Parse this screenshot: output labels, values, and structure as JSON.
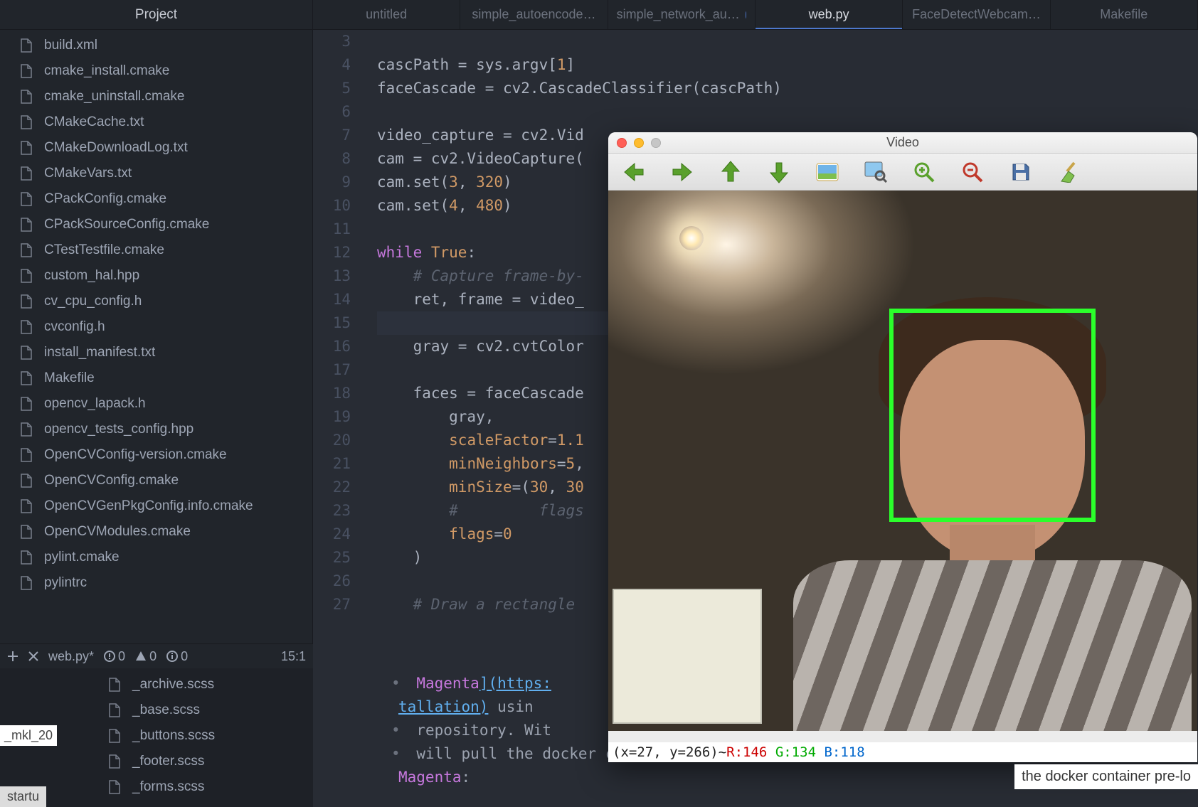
{
  "sidebar": {
    "title": "Project",
    "items": [
      "build.xml",
      "cmake_install.cmake",
      "cmake_uninstall.cmake",
      "CMakeCache.txt",
      "CMakeDownloadLog.txt",
      "CMakeVars.txt",
      "CPackConfig.cmake",
      "CPackSourceConfig.cmake",
      "CTestTestfile.cmake",
      "custom_hal.hpp",
      "cv_cpu_config.h",
      "cvconfig.h",
      "install_manifest.txt",
      "Makefile",
      "opencv_lapack.h",
      "opencv_tests_config.hpp",
      "OpenCVConfig-version.cmake",
      "OpenCVConfig.cmake",
      "OpenCVGenPkgConfig.info.cmake",
      "OpenCVModules.cmake",
      "pylint.cmake",
      "pylintrc"
    ]
  },
  "tabs": [
    {
      "label": "untitled",
      "active": false,
      "modified": false
    },
    {
      "label": "simple_autoencode…",
      "active": false,
      "modified": false
    },
    {
      "label": "simple_network_au…",
      "active": false,
      "modified": true
    },
    {
      "label": "web.py",
      "active": true,
      "modified": false
    },
    {
      "label": "FaceDetectWebcam…",
      "active": false,
      "modified": false
    },
    {
      "label": "Makefile",
      "active": false,
      "modified": false
    }
  ],
  "gutter_start": 3,
  "gutter_end": 27,
  "code": {
    "l3": "",
    "l4_a": "cascPath = sys.argv[",
    "l4_b": "1",
    "l4_c": "]",
    "l5": "faceCascade = cv2.CascadeClassifier(cascPath)",
    "l6": "",
    "l7": "video_capture = cv2.Vid",
    "l8": "cam = cv2.VideoCapture(",
    "l9_a": "cam.set(",
    "l9_b": "3",
    "l9_c": ", ",
    "l9_d": "320",
    "l9_e": ")",
    "l10_a": "cam.set(",
    "l10_b": "4",
    "l10_c": ", ",
    "l10_d": "480",
    "l10_e": ")",
    "l11": "",
    "l12_a": "while",
    "l12_b": " True",
    "l12_c": ":",
    "l13": "    # Capture frame-by-",
    "l14": "    ret, frame = video_",
    "l15": "",
    "l16": "    gray = cv2.cvtColor",
    "l17": "",
    "l18": "    faces = faceCascade",
    "l19": "        gray,",
    "l20_a": "        ",
    "l20_b": "scaleFactor",
    "l20_c": "=",
    "l20_d": "1.1",
    "l21_a": "        ",
    "l21_b": "minNeighbors",
    "l21_c": "=",
    "l21_d": "5",
    "l21_e": ",",
    "l22_a": "        ",
    "l22_b": "minSize",
    "l22_c": "=(",
    "l22_d": "30",
    "l22_e": ", ",
    "l22_f": "30",
    "l23_a": "        ",
    "l23_b": "#         flags",
    "l24_a": "        ",
    "l24_b": "flags",
    "l24_c": "=",
    "l24_d": "0",
    "l25": "    )",
    "l26": "",
    "l27": "    # Draw a rectangle "
  },
  "status": {
    "file": "web.py*",
    "err": "0",
    "warn": "0",
    "info": "0",
    "cursor": "15:1"
  },
  "lower_tree": [
    "_archive.scss",
    "_base.scss",
    "_buttons.scss",
    "_footer.scss",
    "_forms.scss"
  ],
  "lower_lines": {
    "a1": "Magenta",
    "a2": "](https:",
    "b1": "tallation)",
    "b2": "  usin",
    "c": " repository. Wit",
    "d": " will pull the docker container pre loaded with",
    "e1": "Magenta",
    "e2": ":"
  },
  "video": {
    "title": "Video",
    "toolbar": [
      "arrow-left",
      "arrow-right",
      "arrow-up",
      "arrow-down",
      "image",
      "search-image",
      "zoom-in",
      "zoom-out",
      "save",
      "broom"
    ],
    "readout": {
      "coords": "(x=27, y=266)",
      "sep": " ~ ",
      "r": "R:146",
      "g": "G:134",
      "b": "B:118"
    }
  },
  "peek": "the docker container pre-lo",
  "mkl": "_mkl_20",
  "startu": "startu"
}
